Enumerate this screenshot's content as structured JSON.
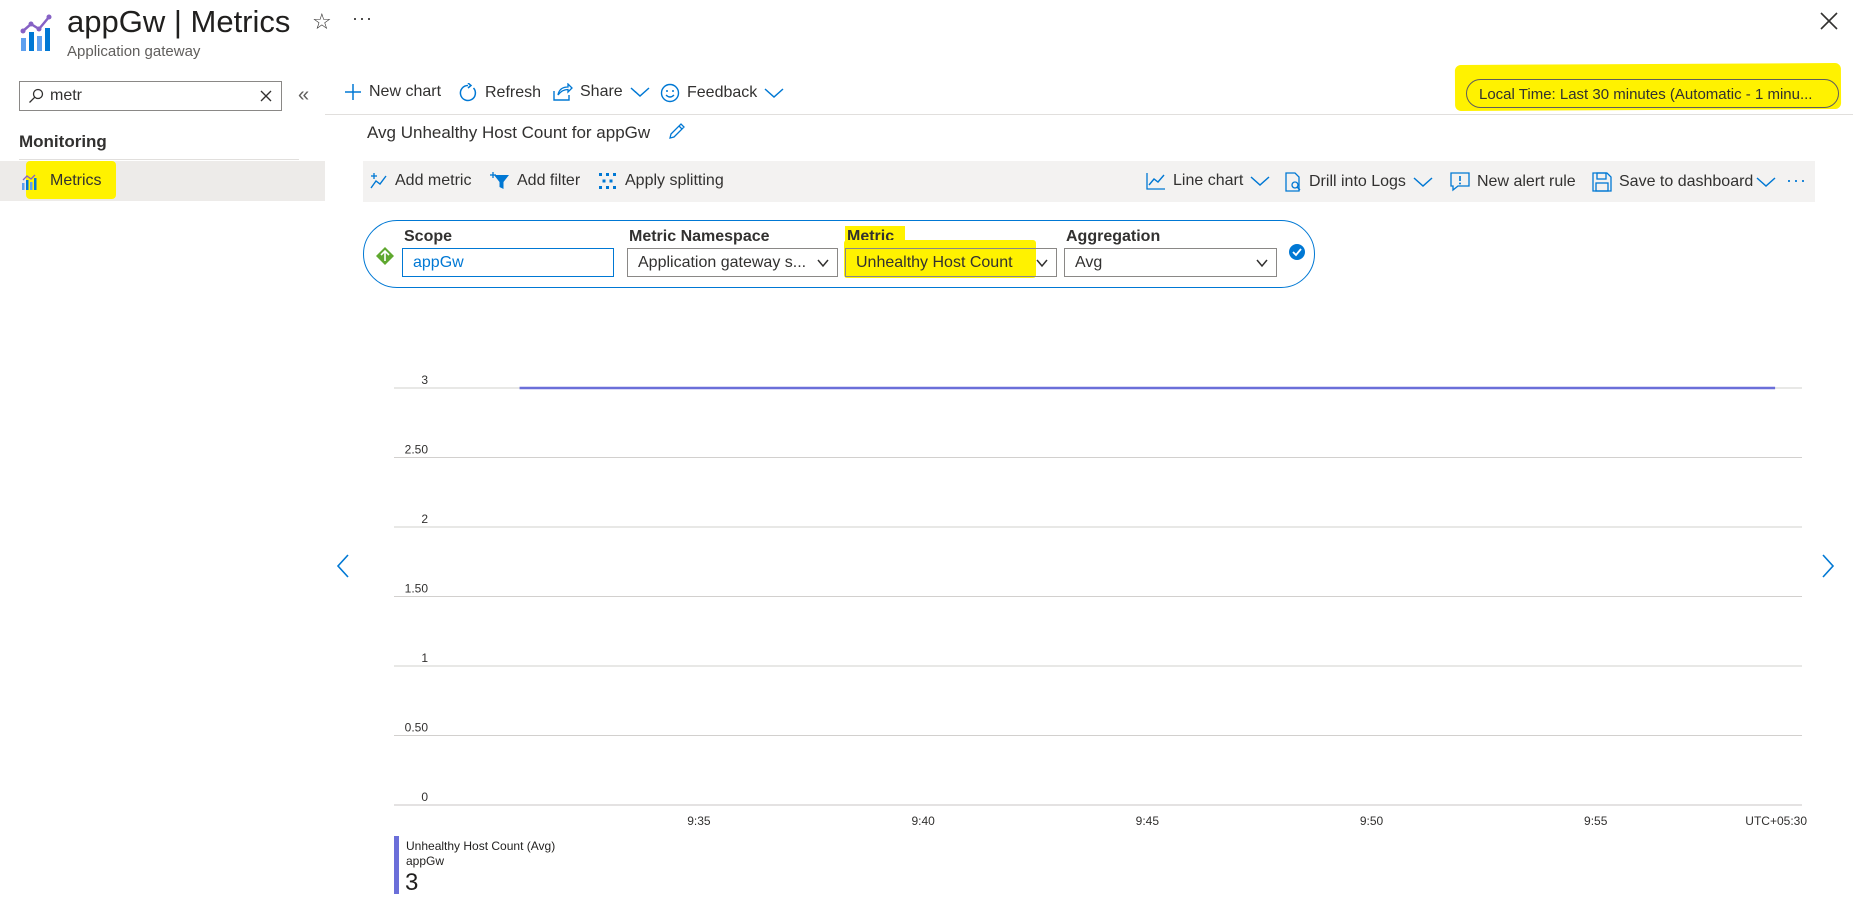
{
  "header": {
    "title": "appGw | Metrics",
    "subtitle": "Application gateway"
  },
  "sidebar": {
    "search_value": "metr",
    "section_heading": "Monitoring",
    "items": [
      {
        "label": "Metrics",
        "selected": true
      }
    ]
  },
  "toolbar": {
    "new_chart": "New chart",
    "refresh": "Refresh",
    "share": "Share",
    "feedback": "Feedback",
    "time_range": "Local Time: Last 30 minutes (Automatic - 1 minu..."
  },
  "chart_title": "Avg Unhealthy Host Count for appGw",
  "chart_toolbar": {
    "add_metric": "Add metric",
    "add_filter": "Add filter",
    "apply_splitting": "Apply splitting",
    "line_chart": "Line chart",
    "drill_logs": "Drill into Logs",
    "new_alert": "New alert rule",
    "save_dashboard": "Save to dashboard"
  },
  "metric_selector": {
    "scope_label": "Scope",
    "scope_value": "appGw",
    "namespace_label": "Metric Namespace",
    "namespace_value": "Application gateway s...",
    "metric_label": "Metric",
    "metric_value": "Unhealthy Host Count",
    "aggregation_label": "Aggregation",
    "aggregation_value": "Avg"
  },
  "chart_data": {
    "type": "line",
    "x_ticks": [
      "9:35",
      "9:40",
      "9:45",
      "9:50",
      "9:55"
    ],
    "y_ticks": [
      "0",
      "0.50",
      "1",
      "1.50",
      "2",
      "2.50",
      "3"
    ],
    "ylim": [
      0,
      3
    ],
    "timezone": "UTC+05:30",
    "grid": true,
    "series": [
      {
        "name": "Unhealthy Host Count (Avg)",
        "resource": "appGw",
        "color": "#6b6fd9",
        "values": [
          3,
          3
        ],
        "x_span": [
          "9:31",
          "9:59"
        ]
      }
    ],
    "legend": {
      "series_label": "Unhealthy Host Count (Avg)",
      "resource": "appGw",
      "value": "3"
    }
  },
  "colors": {
    "accent": "#0078d4",
    "highlight": "#fff200",
    "series": "#6b6fd9"
  }
}
